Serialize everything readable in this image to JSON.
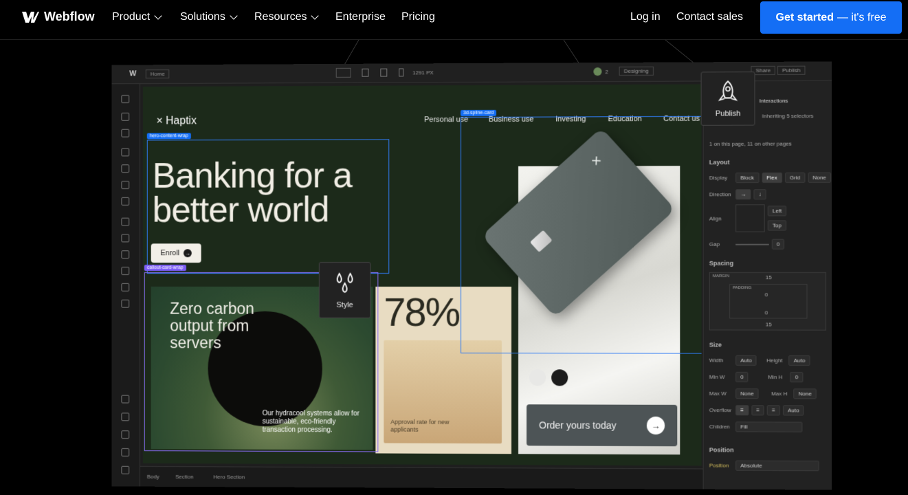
{
  "topnav": {
    "logo": "Webflow",
    "items": [
      "Product",
      "Solutions",
      "Resources",
      "Enterprise",
      "Pricing"
    ],
    "login": "Log in",
    "contact": "Contact sales",
    "cta_main": "Get started",
    "cta_suffix": "— it's free"
  },
  "editor": {
    "page": "Home",
    "breakpoint_width": "1291 PX",
    "collaborators": "2",
    "mode": "Designing",
    "share": "Share",
    "publish": "Publish",
    "breadcrumbs": [
      "Body",
      "Section",
      "Hero Section"
    ]
  },
  "canvas": {
    "brand": "Haptix",
    "nav": [
      "Personal use",
      "Business use",
      "Investing",
      "Education",
      "Contact us"
    ],
    "enroll": "Enroll",
    "hero_line1": "Banking for a",
    "hero_line2": "better world",
    "tags": {
      "hero": "hero-content-wrap",
      "callout": "callout-card-wrap",
      "spline": "3d-spline-card"
    },
    "water_title_1": "Zero carbon",
    "water_title_2": "output from",
    "water_title_3": "servers",
    "water_copy": "Our hydracool systems allow for sustainable, eco-friendly transaction processing.",
    "stat": "78%",
    "stat_caption": "Approval rate for new applicants",
    "order": "Order yours today",
    "swatches": [
      "#e8e8e6",
      "#1c1c1c"
    ]
  },
  "tiles": {
    "publish": "Publish",
    "style": "Style"
  },
  "right_panel": {
    "tab": "Interactions",
    "inherit": "Inheriting 5 selectors",
    "usage": "1 on this page, 11 on other pages",
    "layout": "Layout",
    "display": "Display",
    "display_opts": [
      "Block",
      "Flex",
      "Grid",
      "None"
    ],
    "direction": "Direction",
    "align": "Align",
    "x_val": "Left",
    "y_val": "Top",
    "gap": "Gap",
    "gap_val": "0",
    "spacing": "Spacing",
    "margin": "MARGIN",
    "padding": "PADDING",
    "margin_top": "15",
    "margin_bottom": "15",
    "zero": "0",
    "size": "Size",
    "width": "Width",
    "height": "Height",
    "auto": "Auto",
    "min_w": "Min W",
    "min_h": "Min H",
    "max_w": "Max W",
    "max_h": "Max H",
    "none": "None",
    "overflow": "Overflow",
    "children": "Children",
    "children_val": "Fill",
    "position": "Position",
    "position_val": "Absolute"
  }
}
